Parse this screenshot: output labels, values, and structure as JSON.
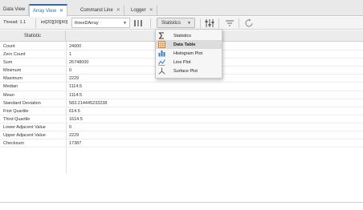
{
  "tabs": [
    {
      "label": "Data View",
      "active": false
    },
    {
      "label": "Array View",
      "active": true
    },
    {
      "label": "Command Line",
      "active": false
    },
    {
      "label": "Logger",
      "active": false
    }
  ],
  "toolbar": {
    "thread_label": "Thread: 1.1",
    "array_expr": "int[20][30][40]",
    "variable": "threeDArray",
    "statistics_label": "Statistics"
  },
  "grid": {
    "header": "Statistic",
    "rows": [
      {
        "label": "Count",
        "value": "24000"
      },
      {
        "label": "Zero Count",
        "value": "1"
      },
      {
        "label": "Sum",
        "value": "26748000"
      },
      {
        "label": "Minimum",
        "value": "0"
      },
      {
        "label": "Maximum",
        "value": "2229"
      },
      {
        "label": "Median",
        "value": "1114.5"
      },
      {
        "label": "Mean",
        "value": "1114.5"
      },
      {
        "label": "Standard Deviation",
        "value": "583.214445233238"
      },
      {
        "label": "First Quartile",
        "value": "614.5"
      },
      {
        "label": "Third Quartile",
        "value": "1614.5"
      },
      {
        "label": "Lower Adjacent Value",
        "value": "0"
      },
      {
        "label": "Upper Adjacent Value",
        "value": "2229"
      },
      {
        "label": "Checksum",
        "value": "17387"
      }
    ]
  },
  "menu": {
    "items": [
      {
        "label": "Statistics",
        "icon": "sigma-icon"
      },
      {
        "label": "Data Table",
        "icon": "table-icon"
      },
      {
        "label": "Histogram Plot",
        "icon": "histogram-icon"
      },
      {
        "label": "Line Plot",
        "icon": "line-plot-icon"
      },
      {
        "label": "Surface Plot",
        "icon": "surface-plot-icon"
      }
    ]
  },
  "colors": {
    "accent": "#2b6fb3",
    "menu_icon_blue": "#3a78c2",
    "menu_icon_orange": "#e07b2a"
  }
}
